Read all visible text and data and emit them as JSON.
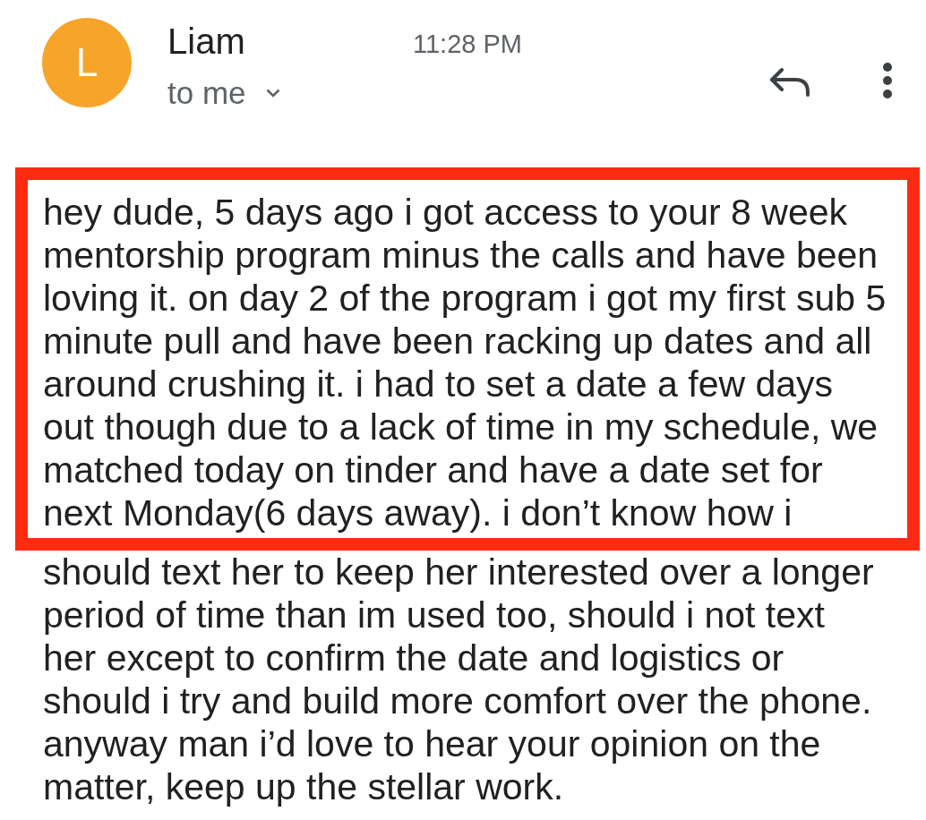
{
  "sender": {
    "avatar_letter": "L",
    "name": "Liam",
    "time": "11:28 PM",
    "recipient": "to me"
  },
  "message": {
    "highlighted_lines": [
      "hey dude, 5 days ago i got access to your 8 week",
      "mentorship program minus the calls and have been",
      "loving it. on day 2 of the program i got my first sub 5",
      "minute pull and have been racking up dates and all",
      "around crushing it. i had to set a date a few days",
      "out though due to a lack of time in my schedule, we",
      "matched today on tinder and have a date set for",
      "next Monday(6 days away). i don’t know how i"
    ],
    "remaining_lines": [
      "should text her to keep her interested over a longer",
      "period of time than im used too, should i not text",
      "her except to confirm the date and logistics or",
      "should i try and build more comfort over the phone.",
      "anyway man i’d love to hear your opinion on the",
      "matter, keep up the stellar work."
    ]
  }
}
